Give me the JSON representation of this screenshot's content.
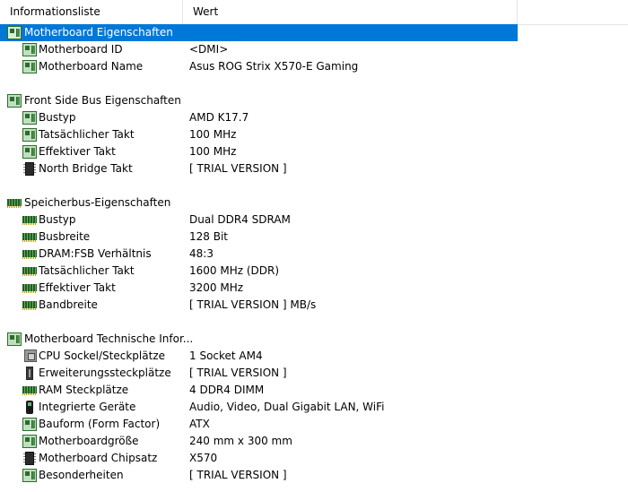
{
  "header": {
    "col_field": "Informationsliste",
    "col_value": "Wert"
  },
  "sections": [
    {
      "title": "Motherboard Eigenschaften",
      "icon": "motherboard-icon",
      "selected": true,
      "items": [
        {
          "label": "Motherboard ID",
          "value": "<DMI>",
          "icon": "motherboard-icon"
        },
        {
          "label": "Motherboard Name",
          "value": "Asus ROG Strix X570-E Gaming",
          "icon": "motherboard-icon"
        }
      ]
    },
    {
      "title": "Front Side Bus Eigenschaften",
      "icon": "motherboard-icon",
      "items": [
        {
          "label": "Bustyp",
          "value": "AMD K17.7",
          "icon": "motherboard-icon"
        },
        {
          "label": "Tatsächlicher Takt",
          "value": "100 MHz",
          "icon": "motherboard-icon"
        },
        {
          "label": "Effektiver Takt",
          "value": "100 MHz",
          "icon": "motherboard-icon"
        },
        {
          "label": "North Bridge Takt",
          "value": "[ TRIAL VERSION ]",
          "icon": "chip-icon"
        }
      ]
    },
    {
      "title": "Speicherbus-Eigenschaften",
      "icon": "memory-icon",
      "items": [
        {
          "label": "Bustyp",
          "value": "Dual DDR4 SDRAM",
          "icon": "memory-icon"
        },
        {
          "label": "Busbreite",
          "value": "128 Bit",
          "icon": "memory-icon"
        },
        {
          "label": "DRAM:FSB Verhältnis",
          "value": "48:3",
          "icon": "memory-icon"
        },
        {
          "label": "Tatsächlicher Takt",
          "value": "1600 MHz (DDR)",
          "icon": "memory-icon"
        },
        {
          "label": "Effektiver Takt",
          "value": "3200 MHz",
          "icon": "memory-icon"
        },
        {
          "label": "Bandbreite",
          "value": "[ TRIAL VERSION ] MB/s",
          "icon": "memory-icon"
        }
      ]
    },
    {
      "title": "Motherboard Technische Infor...",
      "icon": "motherboard-icon",
      "items": [
        {
          "label": "CPU Sockel/Steckplätze",
          "value": "1 Socket AM4",
          "icon": "cpu-icon"
        },
        {
          "label": "Erweiterungssteckplätze",
          "value": "[ TRIAL VERSION ]",
          "icon": "slot-icon"
        },
        {
          "label": "RAM Steckplätze",
          "value": "4 DDR4 DIMM",
          "icon": "memory-icon"
        },
        {
          "label": "Integrierte Geräte",
          "value": "Audio, Video, Dual Gigabit LAN, WiFi",
          "icon": "device-icon"
        },
        {
          "label": "Bauform (Form Factor)",
          "value": "ATX",
          "icon": "motherboard-icon"
        },
        {
          "label": "Motherboardgröße",
          "value": "240 mm x 300 mm",
          "icon": "motherboard-icon"
        },
        {
          "label": "Motherboard Chipsatz",
          "value": "X570",
          "icon": "chip-icon"
        },
        {
          "label": "Besonderheiten",
          "value": "[ TRIAL VERSION ]",
          "icon": "motherboard-icon"
        }
      ]
    }
  ],
  "colors": {
    "selection": "#0078d7",
    "header_border": "#e5e5e5"
  }
}
